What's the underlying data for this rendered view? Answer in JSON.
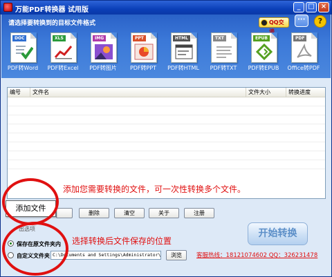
{
  "window": {
    "title": "万能PDF转换器 试用版",
    "min": "_",
    "max": "□",
    "close": "×"
  },
  "header": {
    "hint": "请选择要转换到的目标文件格式",
    "qq_label": "QQ交谈",
    "help_glyph": "?"
  },
  "formats": [
    {
      "tag": "DOC",
      "label": "PDF转Word",
      "color": "#2f6fd1"
    },
    {
      "tag": "XLS",
      "label": "PDF转Excel",
      "color": "#2a9a3a"
    },
    {
      "tag": "IMG",
      "label": "PDF转图片",
      "color": "#b03aa8"
    },
    {
      "tag": "PPT",
      "label": "PDF转PPT",
      "color": "#d8502a"
    },
    {
      "tag": "HTML",
      "label": "PDF转HTML",
      "color": "#555555"
    },
    {
      "tag": "TXT",
      "label": "PDF转TXT",
      "color": "#888888"
    },
    {
      "tag": "EPUB",
      "label": "PDF转EPUB",
      "color": "#55a020"
    },
    {
      "tag": "PDF",
      "label": "Office转PDF",
      "color": "#777777"
    }
  ],
  "list": {
    "columns": {
      "num": "编号",
      "name": "文件名",
      "size": "文件大小",
      "progress": "转换进度"
    }
  },
  "buttons": {
    "add": "添加文件",
    "delete": "删除",
    "clear": "清空",
    "about": "关于",
    "register": "注册",
    "browse": "浏览",
    "start": "开始转换"
  },
  "annotations": {
    "add_tip": "添加您需要转换的文件，可一次性转换多个文件。",
    "save_tip": "选择转换后文件保存的位置"
  },
  "options": {
    "title": "出选项",
    "same_folder": "保存在原文件夹内",
    "custom_folder": "自定义文件夹",
    "path": "C:\\Documents and Settings\\Administrator\\桌面"
  },
  "contact": "客服热线：18121074602 QQ：326231478",
  "colors": {
    "accent_red": "#e01010",
    "header_blue": "#3b78d8"
  }
}
